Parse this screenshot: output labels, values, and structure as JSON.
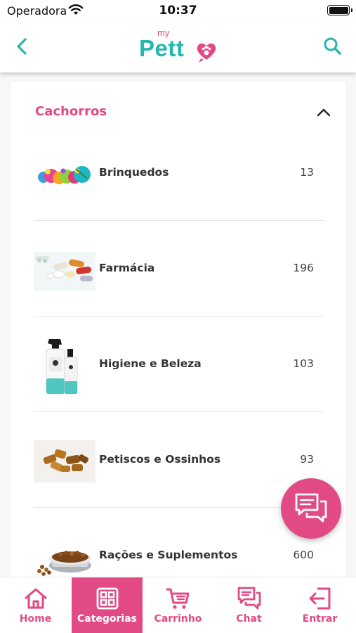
{
  "status_bar": {
    "carrier": "Operadora",
    "time": "10:37"
  },
  "header": {
    "logo_my": "my",
    "logo_name": "Pett",
    "back_icon": "chevron-left-icon",
    "search_icon": "search-icon"
  },
  "category": {
    "title": "Cachorros",
    "expanded": true,
    "items": [
      {
        "label": "Brinquedos",
        "count": "13",
        "image": "toy-balls"
      },
      {
        "label": "Farmácia",
        "count": "196",
        "image": "pills"
      },
      {
        "label": "Higiene e Beleza",
        "count": "103",
        "image": "spray-bottles"
      },
      {
        "label": "Petiscos e Ossinhos",
        "count": "93",
        "image": "dog-treats"
      },
      {
        "label": "Rações e Suplementos",
        "count": "600",
        "image": "food-bowl"
      }
    ]
  },
  "fab": {
    "icon": "chat-bubbles-icon"
  },
  "bottom_nav": [
    {
      "label": "Home",
      "icon": "home-icon",
      "active": false
    },
    {
      "label": "Categorias",
      "icon": "grid-icon",
      "active": true
    },
    {
      "label": "Carrinho",
      "icon": "cart-icon",
      "active": false
    },
    {
      "label": "Chat",
      "icon": "chat-icon",
      "active": false
    },
    {
      "label": "Entrar",
      "icon": "login-icon",
      "active": false
    }
  ],
  "colors": {
    "brand_pink": "#e24a85",
    "brand_teal": "#26b6b0"
  }
}
